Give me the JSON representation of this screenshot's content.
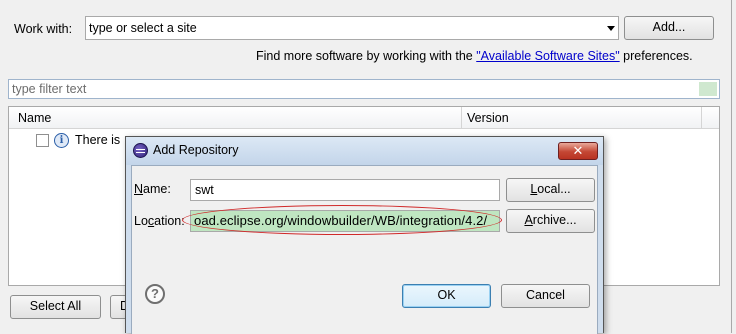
{
  "install_wizard": {
    "work_with_label": "Work with:",
    "site_combo_value": "type or select a site",
    "add_button": "Add...",
    "more_software_prefix": "Find more software by working with the ",
    "available_sites_link": "\"Available Software Sites\"",
    "more_software_suffix": " preferences.",
    "filter_placeholder": "type filter text",
    "table": {
      "columns": [
        "Name",
        "Version"
      ],
      "rows": [
        {
          "text": "There is"
        }
      ]
    },
    "select_all_button": "Select All",
    "deselect_button_partial": "D"
  },
  "add_repository_dialog": {
    "title": "Add Repository",
    "close_glyph": "✕",
    "name_label_mnemonic": "N",
    "name_label_rest": "ame:",
    "name_value": "swt",
    "local_button_mnemonic": "L",
    "local_button_rest": "ocal...",
    "location_label_prefix": "Lo",
    "location_label_mnemonic": "c",
    "location_label_rest": "ation:",
    "location_value": "oad.eclipse.org/windowbuilder/WB/integration/4.2/",
    "archive_button_mnemonic": "A",
    "archive_button_rest": "rchive...",
    "help_glyph": "?",
    "ok_button": "OK",
    "cancel_button": "Cancel",
    "highlight_color": "#bfe6c1",
    "annotation_color": "#d02a2a"
  }
}
